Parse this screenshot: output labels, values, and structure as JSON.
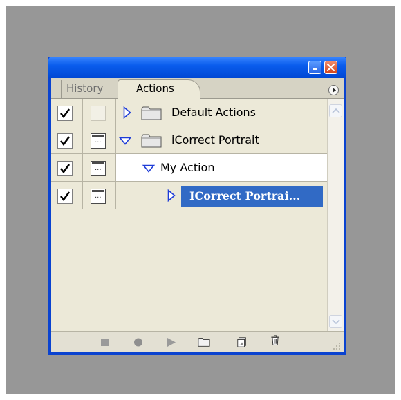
{
  "tabs": [
    {
      "label": "History",
      "active": false
    },
    {
      "label": "Actions",
      "active": true
    }
  ],
  "rows": [
    {
      "name": "Default Actions",
      "checked": true,
      "dialog": false,
      "expanded": false,
      "type": "set"
    },
    {
      "name": "iCorrect Portrait",
      "checked": true,
      "dialog": true,
      "expanded": true,
      "type": "set"
    },
    {
      "name": "My Action",
      "checked": true,
      "dialog": true,
      "expanded": true,
      "type": "action"
    },
    {
      "name": "ICorrect Portrai...",
      "checked": true,
      "dialog": true,
      "expanded": false,
      "type": "step",
      "selected": true
    }
  ],
  "colors": {
    "title_bar": "#0a5ded",
    "selection": "#316ac5",
    "panel_bg": "#ece9d8",
    "backdrop": "#979797"
  },
  "icons": {
    "check": "checkmark-icon",
    "dialog": "dialog-toggle-icon",
    "folder": "folder-icon",
    "expand": "triangle-right-icon",
    "collapse": "triangle-down-icon"
  }
}
